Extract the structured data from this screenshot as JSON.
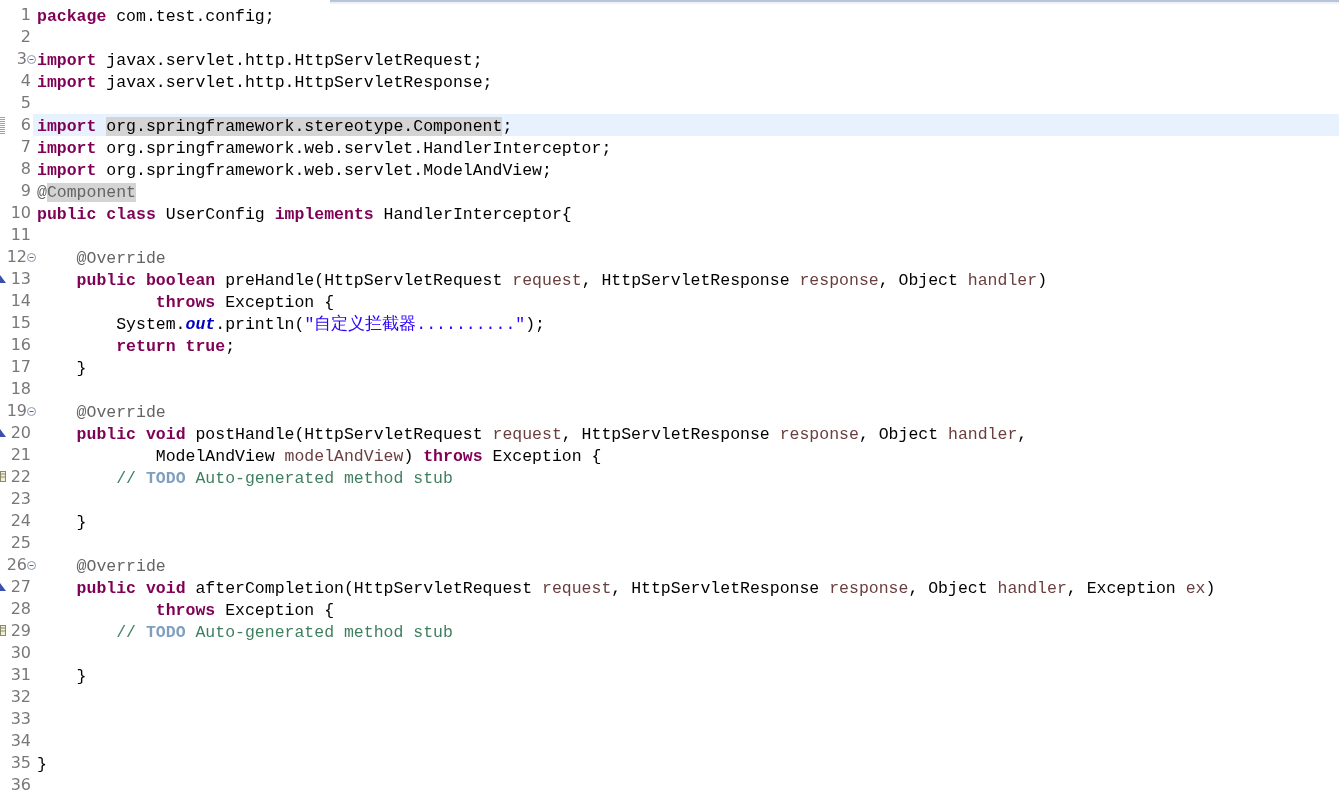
{
  "editor": {
    "lines": [
      {
        "number": "1",
        "kind": "plain",
        "tokens": [
          {
            "text": "package",
            "kind": "keyword"
          },
          {
            "text": " com.test.config;",
            "kind": "plain"
          }
        ]
      },
      {
        "number": "2",
        "kind": "plain"
      },
      {
        "number": "3",
        "kind": "fold",
        "tokens": [
          {
            "text": "import",
            "kind": "keyword"
          },
          {
            "text": " javax.servlet.http.HttpServletRequest;",
            "kind": "plain"
          }
        ]
      },
      {
        "number": "4",
        "kind": "plain",
        "tokens": [
          {
            "text": "import",
            "kind": "keyword"
          },
          {
            "text": " javax.servlet.http.HttpServletResponse;",
            "kind": "plain"
          }
        ]
      },
      {
        "number": "5",
        "kind": "plain"
      },
      {
        "number": "6",
        "kind": "change",
        "current": true,
        "tokens": [
          {
            "text": "import ",
            "kind": "keyword"
          },
          {
            "text": "org.springframework.stereotype.Component",
            "kind": "plain",
            "occurrence": true
          },
          {
            "text": ";",
            "kind": "plain"
          }
        ]
      },
      {
        "number": "7",
        "kind": "plain",
        "tokens": [
          {
            "text": "import",
            "kind": "keyword"
          },
          {
            "text": " org.springframework.web.servlet.HandlerInterceptor;",
            "kind": "plain"
          }
        ]
      },
      {
        "number": "8",
        "kind": "plain",
        "tokens": [
          {
            "text": "import",
            "kind": "keyword"
          },
          {
            "text": " org.springframework.web.servlet.ModelAndView;",
            "kind": "plain"
          }
        ]
      },
      {
        "number": "9",
        "kind": "plain",
        "tokens": [
          {
            "text": "@",
            "kind": "annotation"
          },
          {
            "text": "Component",
            "kind": "annotation",
            "occurrence": true
          }
        ]
      },
      {
        "number": "10",
        "kind": "plain",
        "tokens": [
          {
            "text": "public",
            "kind": "keyword"
          },
          {
            "text": " class",
            "kind": "keyword"
          },
          {
            "text": " UserConfig ",
            "kind": "plain"
          },
          {
            "text": "implements",
            "kind": "keyword"
          },
          {
            "text": " HandlerInterceptor{",
            "kind": "plain"
          }
        ]
      },
      {
        "number": "11",
        "kind": "plain"
      },
      {
        "number": "12",
        "kind": "fold",
        "tokens": [
          {
            "text": "    @Override",
            "kind": "annotation"
          }
        ]
      },
      {
        "number": "13",
        "kind": "override",
        "tokens": [
          {
            "text": "    public",
            "kind": "keyword"
          },
          {
            "text": " boolean",
            "kind": "keyword"
          },
          {
            "text": " preHandle(HttpServletRequest ",
            "kind": "plain"
          },
          {
            "text": "request",
            "kind": "param"
          },
          {
            "text": ", HttpServletResponse ",
            "kind": "plain"
          },
          {
            "text": "response",
            "kind": "param"
          },
          {
            "text": ", Object ",
            "kind": "plain"
          },
          {
            "text": "handler",
            "kind": "param"
          },
          {
            "text": ")",
            "kind": "plain"
          }
        ]
      },
      {
        "number": "14",
        "kind": "plain",
        "tokens": [
          {
            "text": "            throws",
            "kind": "keyword"
          },
          {
            "text": " Exception {",
            "kind": "plain"
          }
        ]
      },
      {
        "number": "15",
        "kind": "plain",
        "tokens": [
          {
            "text": "        System.",
            "kind": "plain"
          },
          {
            "text": "out",
            "kind": "static"
          },
          {
            "text": ".println(",
            "kind": "plain"
          },
          {
            "text": "\"自定义拦截器..........\"",
            "kind": "string"
          },
          {
            "text": ");",
            "kind": "plain"
          }
        ]
      },
      {
        "number": "16",
        "kind": "plain",
        "tokens": [
          {
            "text": "        return",
            "kind": "keyword"
          },
          {
            "text": " true",
            "kind": "keyword"
          },
          {
            "text": ";",
            "kind": "plain"
          }
        ]
      },
      {
        "number": "17",
        "kind": "plain",
        "tokens": [
          {
            "text": "    }",
            "kind": "plain"
          }
        ]
      },
      {
        "number": "18",
        "kind": "plain"
      },
      {
        "number": "19",
        "kind": "fold",
        "tokens": [
          {
            "text": "    @Override",
            "kind": "annotation"
          }
        ]
      },
      {
        "number": "20",
        "kind": "override",
        "tokens": [
          {
            "text": "    public",
            "kind": "keyword"
          },
          {
            "text": " void",
            "kind": "keyword"
          },
          {
            "text": " postHandle(HttpServletRequest ",
            "kind": "plain"
          },
          {
            "text": "request",
            "kind": "param"
          },
          {
            "text": ", HttpServletResponse ",
            "kind": "plain"
          },
          {
            "text": "response",
            "kind": "param"
          },
          {
            "text": ", Object ",
            "kind": "plain"
          },
          {
            "text": "handler",
            "kind": "param"
          },
          {
            "text": ",",
            "kind": "plain"
          }
        ]
      },
      {
        "number": "21",
        "kind": "plain",
        "tokens": [
          {
            "text": "            ModelAndView ",
            "kind": "plain"
          },
          {
            "text": "modelAndView",
            "kind": "param"
          },
          {
            "text": ") ",
            "kind": "plain"
          },
          {
            "text": "throws",
            "kind": "keyword"
          },
          {
            "text": " Exception {",
            "kind": "plain"
          }
        ]
      },
      {
        "number": "22",
        "kind": "task",
        "tokens": [
          {
            "text": "        // ",
            "kind": "comment"
          },
          {
            "text": "TODO",
            "kind": "todo"
          },
          {
            "text": " Auto-generated method stub",
            "kind": "comment"
          }
        ]
      },
      {
        "number": "23",
        "kind": "plain"
      },
      {
        "number": "24",
        "kind": "plain",
        "tokens": [
          {
            "text": "    }",
            "kind": "plain"
          }
        ]
      },
      {
        "number": "25",
        "kind": "plain"
      },
      {
        "number": "26",
        "kind": "fold",
        "tokens": [
          {
            "text": "    @Override",
            "kind": "annotation"
          }
        ]
      },
      {
        "number": "27",
        "kind": "override",
        "tokens": [
          {
            "text": "    public",
            "kind": "keyword"
          },
          {
            "text": " void",
            "kind": "keyword"
          },
          {
            "text": " afterCompletion(HttpServletRequest ",
            "kind": "plain"
          },
          {
            "text": "request",
            "kind": "param"
          },
          {
            "text": ", HttpServletResponse ",
            "kind": "plain"
          },
          {
            "text": "response",
            "kind": "param"
          },
          {
            "text": ", Object ",
            "kind": "plain"
          },
          {
            "text": "handler",
            "kind": "param"
          },
          {
            "text": ", Exception ",
            "kind": "plain"
          },
          {
            "text": "ex",
            "kind": "param"
          },
          {
            "text": ")",
            "kind": "plain"
          }
        ]
      },
      {
        "number": "28",
        "kind": "plain",
        "tokens": [
          {
            "text": "            throws",
            "kind": "keyword"
          },
          {
            "text": " Exception {",
            "kind": "plain"
          }
        ]
      },
      {
        "number": "29",
        "kind": "task",
        "tokens": [
          {
            "text": "        // ",
            "kind": "comment"
          },
          {
            "text": "TODO",
            "kind": "todo"
          },
          {
            "text": " Auto-generated method stub",
            "kind": "comment"
          }
        ]
      },
      {
        "number": "30",
        "kind": "plain"
      },
      {
        "number": "31",
        "kind": "plain",
        "tokens": [
          {
            "text": "    }",
            "kind": "plain"
          }
        ]
      },
      {
        "number": "32",
        "kind": "plain"
      },
      {
        "number": "33",
        "kind": "plain"
      },
      {
        "number": "34",
        "kind": "plain"
      },
      {
        "number": "35",
        "kind": "plain",
        "tokens": [
          {
            "text": "}",
            "kind": "plain"
          }
        ]
      },
      {
        "number": "36",
        "kind": "plain"
      }
    ]
  }
}
